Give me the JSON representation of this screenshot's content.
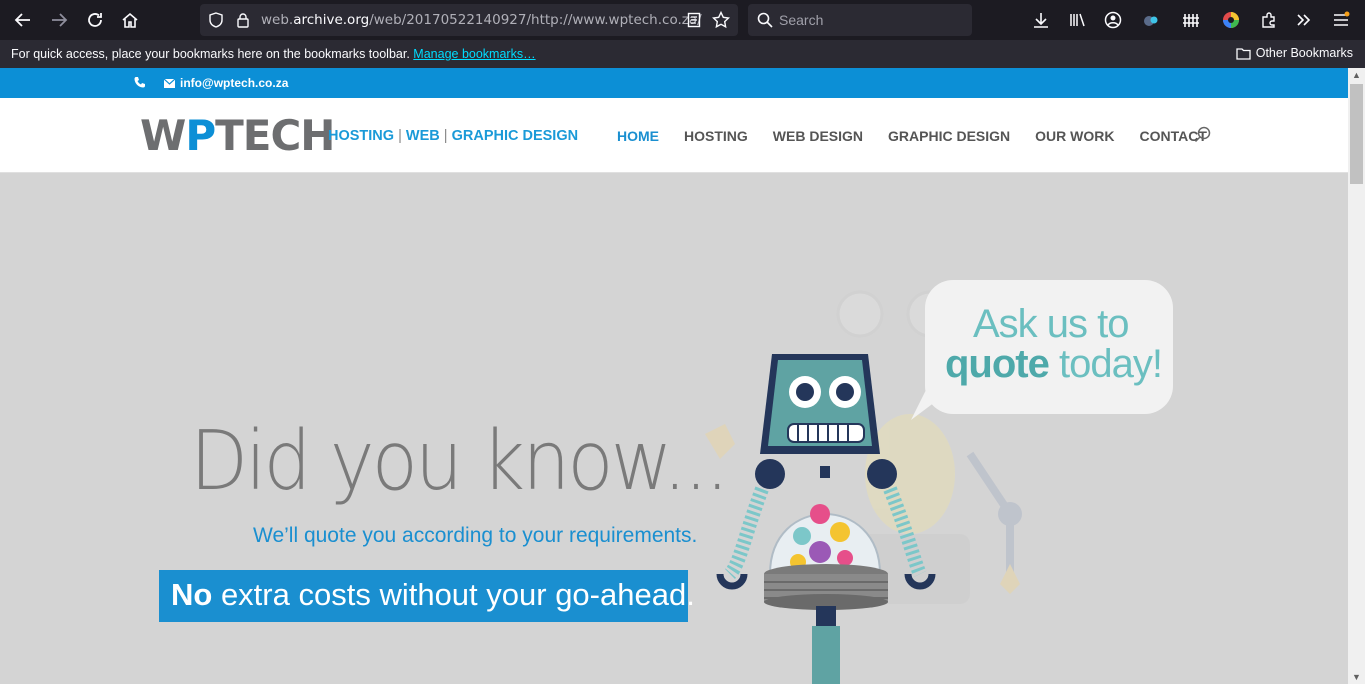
{
  "browser": {
    "url_prefix": "web.",
    "url_host": "archive.org",
    "url_rest": "/web/20170522140927/http://www.wptech.co.za/",
    "search_placeholder": "Search",
    "bookmarks_message": "For quick access, place your bookmarks here on the bookmarks toolbar.",
    "manage_bookmarks": "Manage bookmarks…",
    "other_bookmarks": "Other Bookmarks"
  },
  "site": {
    "email": "info@wptech.co.za",
    "logo_a": "W",
    "logo_p": "P",
    "logo_b": "TECH",
    "tagline": {
      "hosting": "HOSTING",
      "web": "WEB",
      "graphic": "GRAPHIC DESIGN",
      "sep": "|"
    },
    "menu": [
      "HOME",
      "HOSTING",
      "WEB DESIGN",
      "GRAPHIC DESIGN",
      "OUR WORK",
      "CONTACT"
    ]
  },
  "hero": {
    "headline": "Did you know...",
    "subline": "We’ll quote you according to your requirements.",
    "cta_bold": "No",
    "cta_rest": " extra costs without your go-ahead.",
    "bubble_line1": "Ask us to",
    "bubble_bold": "quote",
    "bubble_rest": " today!"
  },
  "colors": {
    "accent": "#1a8fd0",
    "topbar": "#0c8fd6",
    "teal": "#6bbfc0"
  }
}
